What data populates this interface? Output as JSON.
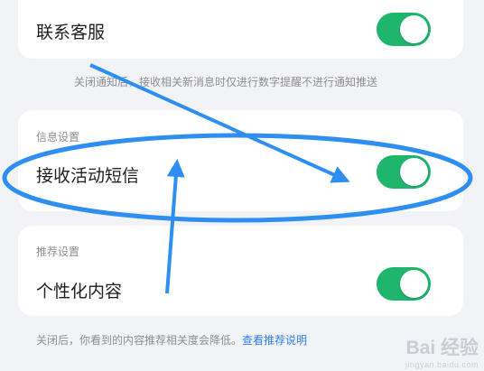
{
  "settings": {
    "contact_support": {
      "label": "联系客服",
      "enabled": true
    },
    "contact_note": "关闭通知后，接收相关新消息时仅进行数字提醒不进行通知推送",
    "info_section": {
      "title": "信息设置",
      "sms_label": "接收活动短信",
      "sms_enabled": true
    },
    "recommend_section": {
      "title": "推荐设置",
      "personalized_label": "个性化内容",
      "personalized_enabled": true
    },
    "recommend_note": "关闭后，你看到的内容推荐相关度会降低。",
    "recommend_link": "查看推荐说明"
  },
  "colors": {
    "toggle_on": "#1fb56d",
    "annotation_blue": "#2f8ff0",
    "link": "#2f7df6",
    "background": "#f2f3f6"
  },
  "watermark": {
    "main": "Bai 经验",
    "sub": "jingyan.baidu.com"
  }
}
